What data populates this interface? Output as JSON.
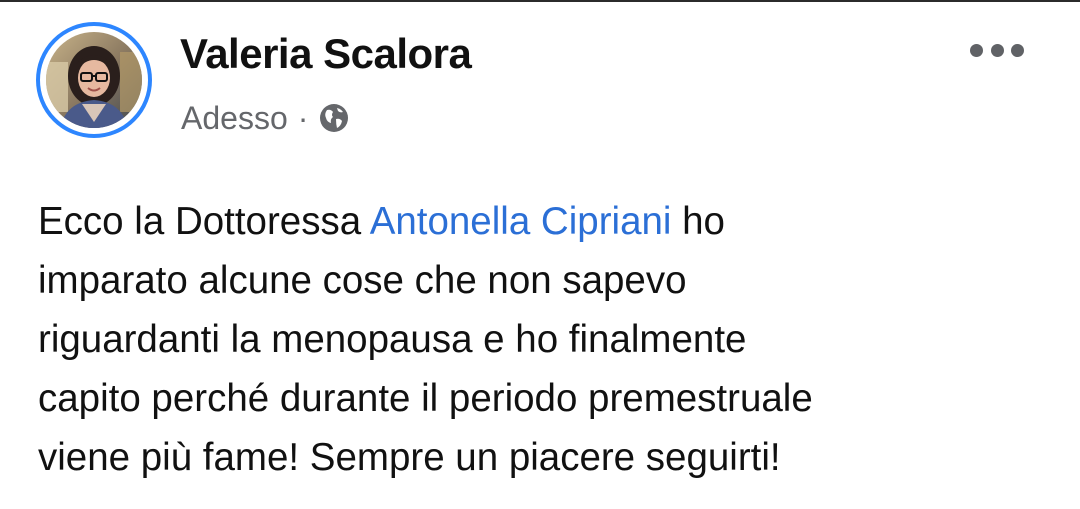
{
  "post": {
    "author": "Valeria Scalora",
    "timestamp": "Adesso",
    "separator": "·",
    "privacy_icon": "globe-icon",
    "more_icon": "more-options-icon",
    "text": {
      "line1_before": "Ecco la Dottoressa ",
      "mention": "Antonella Cipriani",
      "line1_after": " ho",
      "line2": "imparato alcune cose che non sapevo",
      "line3": "riguardanti la menopausa e ho finalmente",
      "line4": "capito perché durante il periodo premestruale",
      "line5": "viene più fame! Sempre un piacere seguirti!"
    }
  },
  "colors": {
    "story_ring": "#2d86ff",
    "mention": "#2b6fd6",
    "meta_text": "#65676b",
    "author_text": "#111111"
  }
}
